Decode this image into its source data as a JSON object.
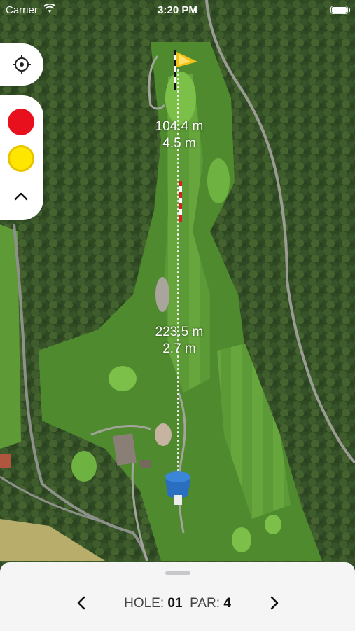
{
  "status": {
    "carrier": "Carrier",
    "time": "3:20 PM"
  },
  "distances": [
    {
      "line1": "104.4 m",
      "line2": "4.5 m"
    },
    {
      "line1": "223.5 m",
      "line2": "2.7 m"
    }
  ],
  "bottom": {
    "hole_label": "HOLE:",
    "hole": "01",
    "par_label": "PAR:",
    "par": "4"
  },
  "colors": {
    "marker_red": "#e8101c",
    "marker_yellow": "#ffe600"
  },
  "icons": [
    "wifi-icon",
    "battery-icon",
    "locate-crosshair-icon",
    "chevron-up-icon",
    "chevron-left-icon",
    "chevron-right-icon",
    "flag-icon",
    "tee-marker-icon"
  ]
}
